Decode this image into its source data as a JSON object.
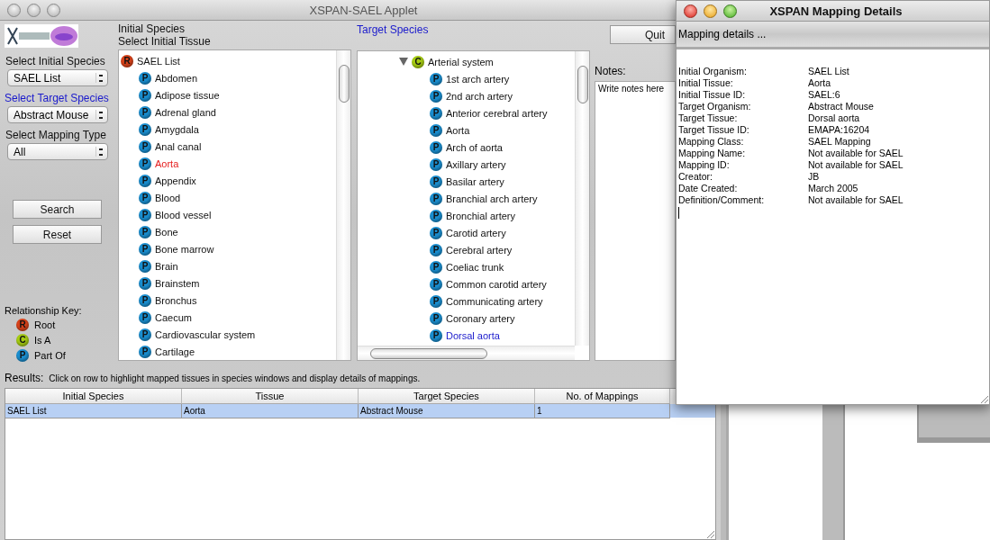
{
  "window": {
    "title": "XSPAN-SAEL Applet"
  },
  "sidebar": {
    "initial_label": "Select Initial Species",
    "initial_value": "SAEL List",
    "target_label": "Select Target Species",
    "target_value": "Abstract Mouse",
    "mapping_label": "Select Mapping Type",
    "mapping_value": "All",
    "buttons": [
      "Search",
      "Reset"
    ],
    "key_title": "Relationship Key:",
    "key": [
      {
        "kind": "root",
        "badge": "R",
        "label": "Root"
      },
      {
        "kind": "is_a",
        "badge": "C",
        "label": "Is A"
      },
      {
        "kind": "part_of",
        "badge": "P",
        "label": "Part Of"
      }
    ]
  },
  "initial_tree": {
    "heading": "Initial Species",
    "subheading": "Select Initial Tissue",
    "root": {
      "kind": "root",
      "badge": "R",
      "label": "SAEL List",
      "children": [
        {
          "kind": "part_of",
          "badge": "P",
          "label": "Abdomen",
          "selected": false
        },
        {
          "kind": "part_of",
          "badge": "P",
          "label": "Adipose tissue",
          "selected": false
        },
        {
          "kind": "part_of",
          "badge": "P",
          "label": "Adrenal gland",
          "selected": false
        },
        {
          "kind": "part_of",
          "badge": "P",
          "label": "Amygdala",
          "selected": false
        },
        {
          "kind": "part_of",
          "badge": "P",
          "label": "Anal canal",
          "selected": false
        },
        {
          "kind": "part_of",
          "badge": "P",
          "label": "Aorta",
          "selected": true
        },
        {
          "kind": "part_of",
          "badge": "P",
          "label": "Appendix",
          "selected": false
        },
        {
          "kind": "part_of",
          "badge": "P",
          "label": "Blood",
          "selected": false
        },
        {
          "kind": "part_of",
          "badge": "P",
          "label": "Blood vessel",
          "selected": false
        },
        {
          "kind": "part_of",
          "badge": "P",
          "label": "Bone",
          "selected": false
        },
        {
          "kind": "part_of",
          "badge": "P",
          "label": "Bone marrow",
          "selected": false
        },
        {
          "kind": "part_of",
          "badge": "P",
          "label": "Brain",
          "selected": false
        },
        {
          "kind": "part_of",
          "badge": "P",
          "label": "Brainstem",
          "selected": false
        },
        {
          "kind": "part_of",
          "badge": "P",
          "label": "Bronchus",
          "selected": false
        },
        {
          "kind": "part_of",
          "badge": "P",
          "label": "Caecum",
          "selected": false
        },
        {
          "kind": "part_of",
          "badge": "P",
          "label": "Cardiovascular system",
          "selected": false
        },
        {
          "kind": "part_of",
          "badge": "P",
          "label": "Cartilage",
          "selected": false
        }
      ]
    }
  },
  "target_tree": {
    "heading": "Target Species",
    "root": {
      "kind": "is_a",
      "badge": "C",
      "label": "Arterial system",
      "expanded": true,
      "children": [
        {
          "kind": "part_of",
          "badge": "P",
          "label": "1st arch artery",
          "selected": false
        },
        {
          "kind": "part_of",
          "badge": "P",
          "label": "2nd arch artery",
          "selected": false
        },
        {
          "kind": "part_of",
          "badge": "P",
          "label": "Anterior cerebral artery",
          "selected": false
        },
        {
          "kind": "part_of",
          "badge": "P",
          "label": "Aorta",
          "selected": false
        },
        {
          "kind": "part_of",
          "badge": "P",
          "label": "Arch of aorta",
          "selected": false
        },
        {
          "kind": "part_of",
          "badge": "P",
          "label": "Axillary artery",
          "selected": false
        },
        {
          "kind": "part_of",
          "badge": "P",
          "label": "Basilar artery",
          "selected": false
        },
        {
          "kind": "part_of",
          "badge": "P",
          "label": "Branchial arch artery",
          "selected": false
        },
        {
          "kind": "part_of",
          "badge": "P",
          "label": "Bronchial artery",
          "selected": false
        },
        {
          "kind": "part_of",
          "badge": "P",
          "label": "Carotid artery",
          "selected": false
        },
        {
          "kind": "part_of",
          "badge": "P",
          "label": "Cerebral artery",
          "selected": false
        },
        {
          "kind": "part_of",
          "badge": "P",
          "label": "Coeliac trunk",
          "selected": false
        },
        {
          "kind": "part_of",
          "badge": "P",
          "label": "Common carotid artery",
          "selected": false
        },
        {
          "kind": "part_of",
          "badge": "P",
          "label": "Communicating artery",
          "selected": false
        },
        {
          "kind": "part_of",
          "badge": "P",
          "label": "Coronary artery",
          "selected": false
        },
        {
          "kind": "part_of",
          "badge": "P",
          "label": "Dorsal aorta",
          "selected": true
        }
      ]
    }
  },
  "quit_button": "Quit",
  "notes": {
    "label": "Notes:",
    "value": "Write notes here"
  },
  "results": {
    "label": "Results:",
    "hint": "Click on row to highlight mapped tissues in species windows and display details of mappings.",
    "table": {
      "columns": [
        "Initial Species",
        "Tissue",
        "Target Species",
        "No. of Mappings"
      ],
      "rows": [
        {
          "cells": [
            "SAEL List",
            "Aorta",
            "Abstract Mouse",
            "1"
          ],
          "selected": true
        }
      ]
    }
  },
  "details_window": {
    "title": "XSPAN Mapping Details",
    "header": "Mapping details ...",
    "fields": [
      {
        "label": "Initial Organism:",
        "value": "SAEL List"
      },
      {
        "label": "Initial Tissue:",
        "value": "Aorta"
      },
      {
        "label": "Initial Tissue ID:",
        "value": "SAEL:6"
      },
      {
        "label": "Target Organism:",
        "value": "Abstract Mouse"
      },
      {
        "label": "Target Tissue:",
        "value": "Dorsal aorta"
      },
      {
        "label": "Target Tissue ID:",
        "value": "EMAPA:16204"
      },
      {
        "label": "Mapping Class:",
        "value": "SAEL Mapping"
      },
      {
        "label": "Mapping Name:",
        "value": "Not available for SAEL"
      },
      {
        "label": "Mapping ID:",
        "value": "Not available for SAEL"
      },
      {
        "label": "Creator:",
        "value": "JB"
      },
      {
        "label": "Date Created:",
        "value": "March 2005"
      },
      {
        "label": "Definition/Comment:",
        "value": "Not available for SAEL"
      }
    ]
  }
}
